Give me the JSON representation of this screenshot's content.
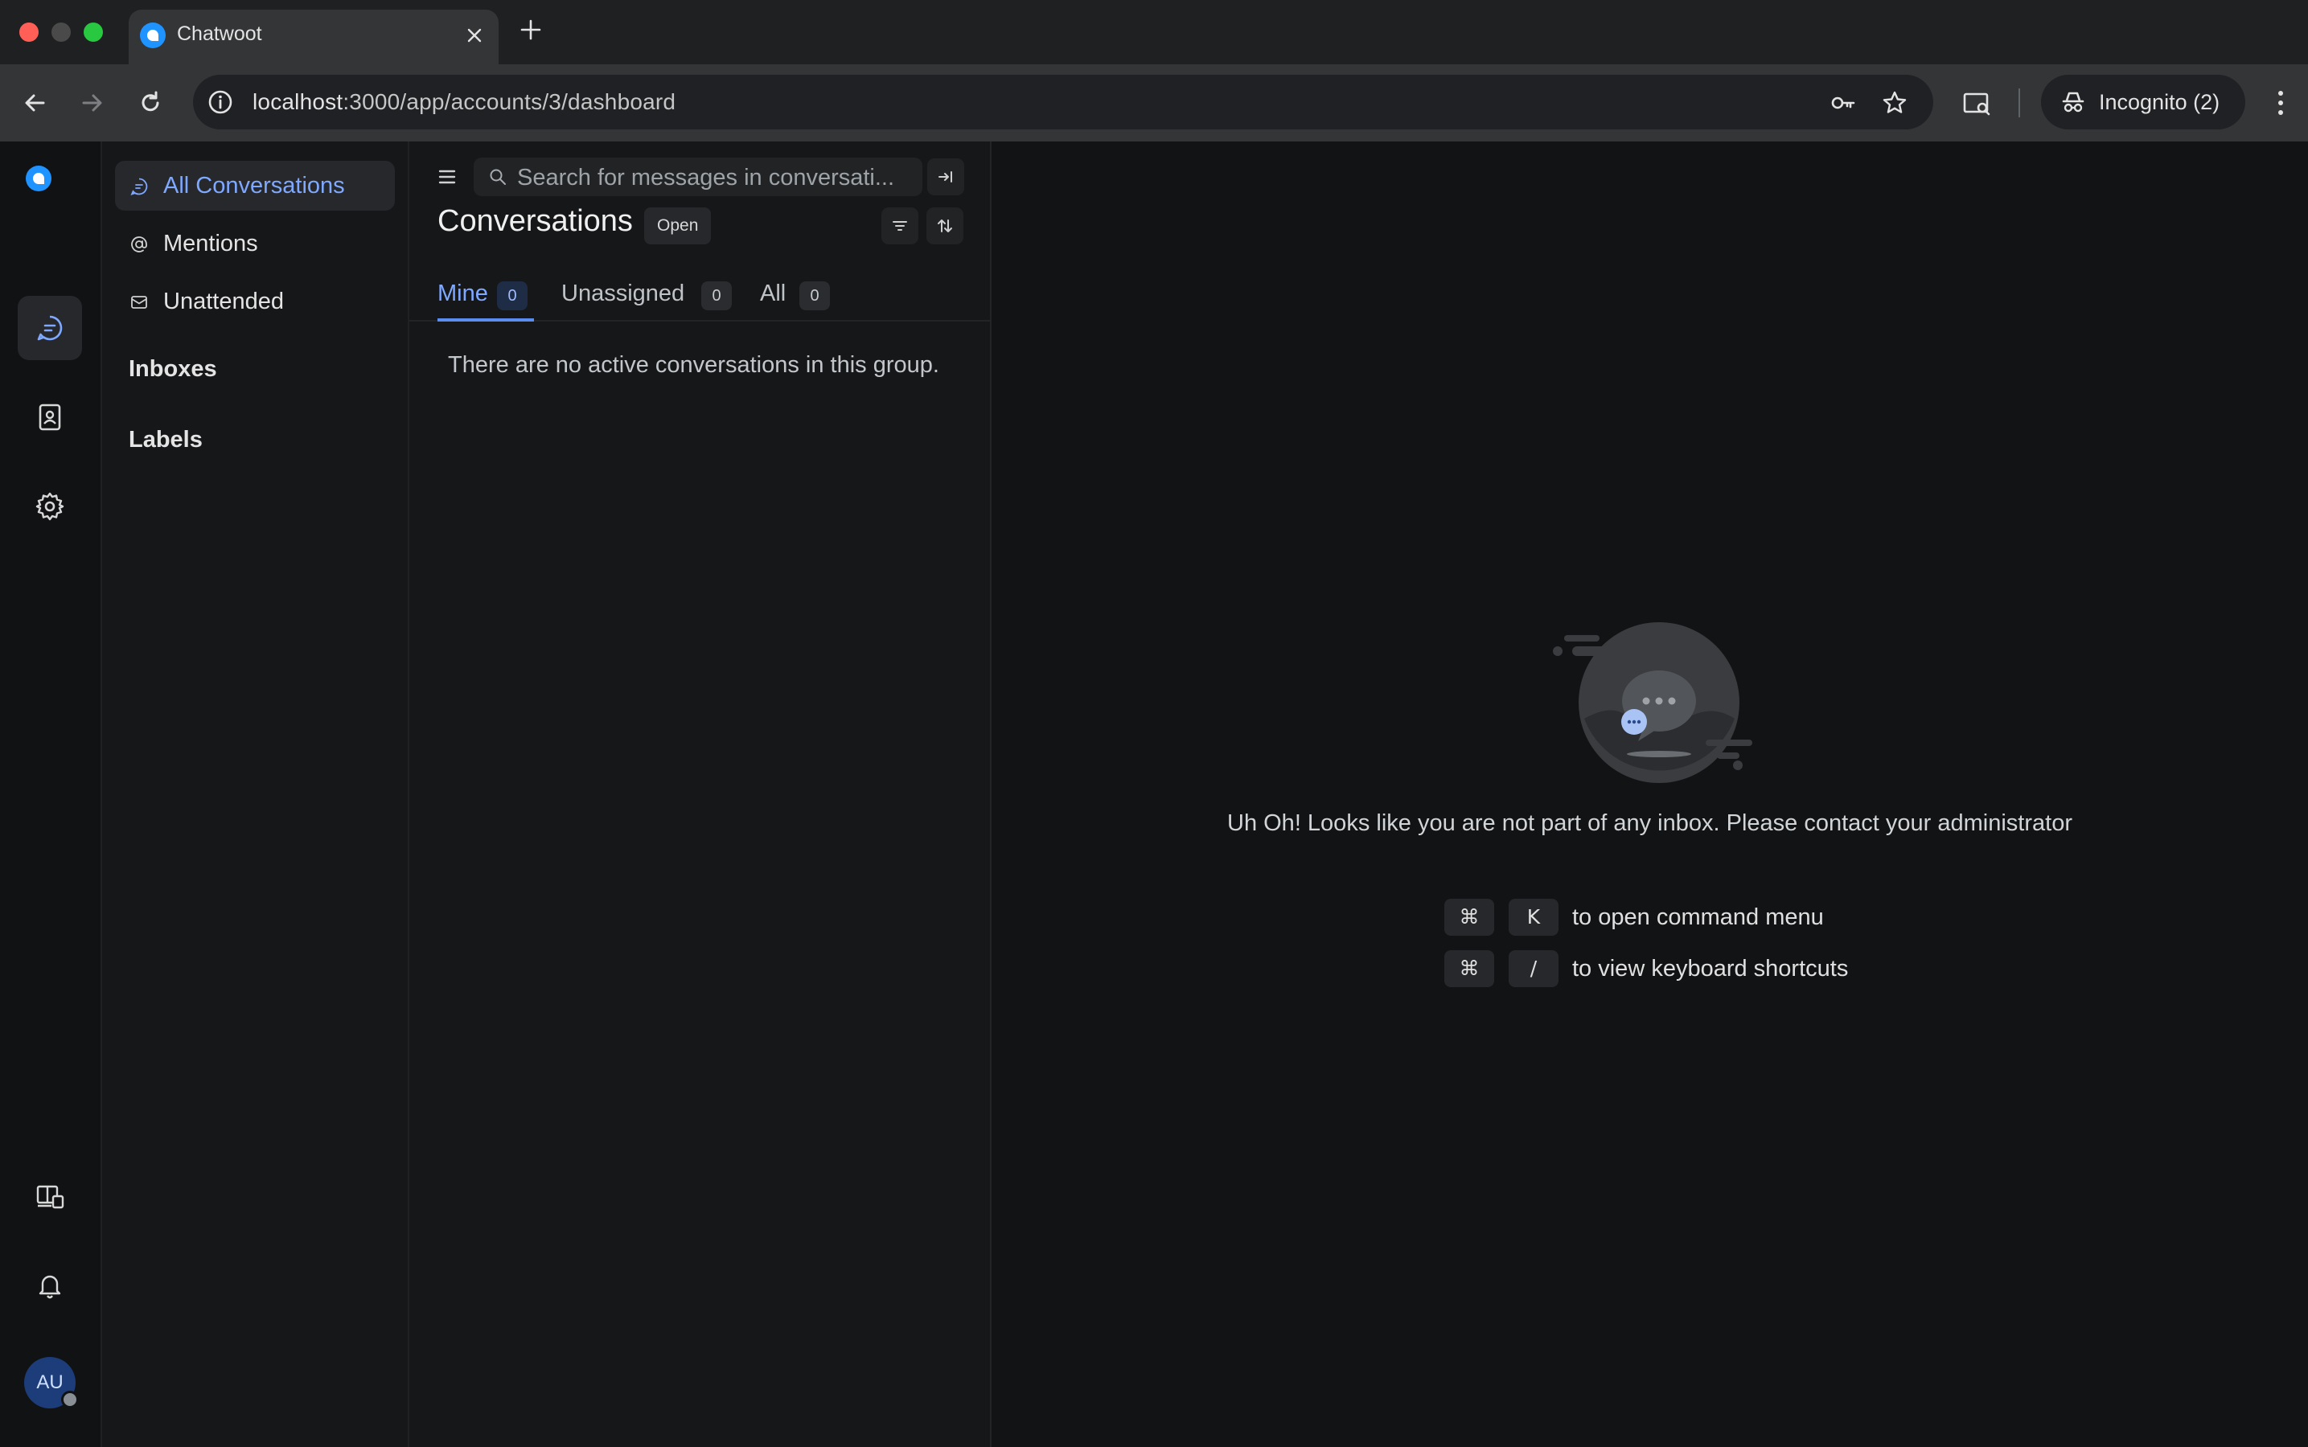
{
  "browser": {
    "tab_title": "Chatwoot",
    "url_host": "localhost",
    "url_path": ":3000/app/accounts/3/dashboard",
    "incognito_label": "Incognito (2)",
    "traffic_colors": [
      "#ff5f57",
      "#4a4a4a",
      "#28c840"
    ]
  },
  "rail": {
    "avatar_initials": "AU",
    "icons": [
      "chatwoot-logo-icon",
      "conversations-icon",
      "contacts-icon",
      "settings-icon",
      "whats-new-icon",
      "notifications-icon"
    ]
  },
  "sidebar": {
    "items": [
      {
        "label": "All Conversations",
        "icon": "chat-bubble-icon",
        "active": true
      },
      {
        "label": "Mentions",
        "icon": "at-sign-icon"
      },
      {
        "label": "Unattended",
        "icon": "mail-icon"
      }
    ],
    "inboxes_heading": "Inboxes",
    "labels_heading": "Labels"
  },
  "conversations": {
    "search_placeholder": "Search for messages in conversati...",
    "title": "Conversations",
    "status": "Open",
    "tabs": [
      {
        "label": "Mine",
        "count": "0",
        "active": true
      },
      {
        "label": "Unassigned",
        "count": "0"
      },
      {
        "label": "All",
        "count": "0"
      }
    ],
    "empty_message": "There are no active conversations in this group."
  },
  "main": {
    "message": "Uh Oh! Looks like you are not part of any inbox. Please contact your administrator",
    "shortcuts": [
      {
        "key1": "⌘",
        "key2": "K",
        "text": "to open command menu"
      },
      {
        "key1": "⌘",
        "key2": "/",
        "text": "to view keyboard shortcuts"
      }
    ]
  },
  "colors": {
    "accent": "#7fa8ff",
    "brand_blue": "#1f93ff",
    "background": "#121314"
  }
}
